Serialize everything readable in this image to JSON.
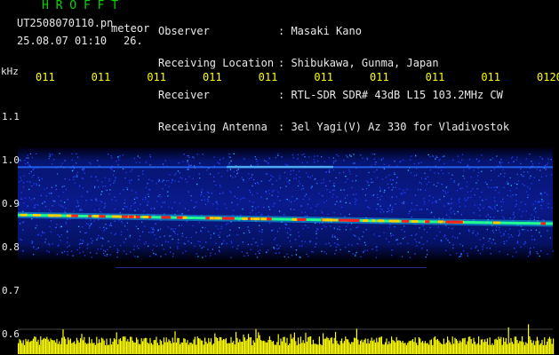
{
  "header": {
    "logo": "H R O F F T",
    "filename": "UT2508070110.pn",
    "tag": "meteor",
    "datetime": "25.08.07 01:10",
    "bucket": "26.",
    "info_rows": [
      {
        "label": "Observer",
        "value": ": Masaki Kano"
      },
      {
        "label": "Receiving Location",
        "value": ": Shibukawa, Gunma, Japan"
      },
      {
        "label": "Receiver",
        "value": ": RTL-SDR SDR# 43dB L15 103.2MHz CW"
      },
      {
        "label": "Receiving Antenna",
        "value": ": 3el Yagi(V) Az 330 for Vladivostok"
      }
    ]
  },
  "axis": {
    "unit": "kHz",
    "y_ticks": [
      "1.1",
      "1.0",
      "0.9",
      "0.8",
      "0.7",
      "0.6"
    ],
    "time_labels": [
      "011",
      "011",
      "011",
      "011",
      "011",
      "011",
      "011",
      "011",
      "011",
      "0120"
    ]
  },
  "colors": {
    "background": "#000000",
    "header_text": "#00e000",
    "axis_text": "#e8e8e8",
    "time_labels": "#ffff00",
    "bars": "#ffff00",
    "waterfall_base": "#0a1a8c"
  },
  "chart_data": {
    "type": "heatmap",
    "ylabel": "kHz",
    "ylim": [
      0.6,
      1.13
    ],
    "carrier_khz_start": 0.875,
    "carrier_khz_end": 0.855,
    "secondary_line_khz": 0.985,
    "weak_line_khz": 0.755
  }
}
